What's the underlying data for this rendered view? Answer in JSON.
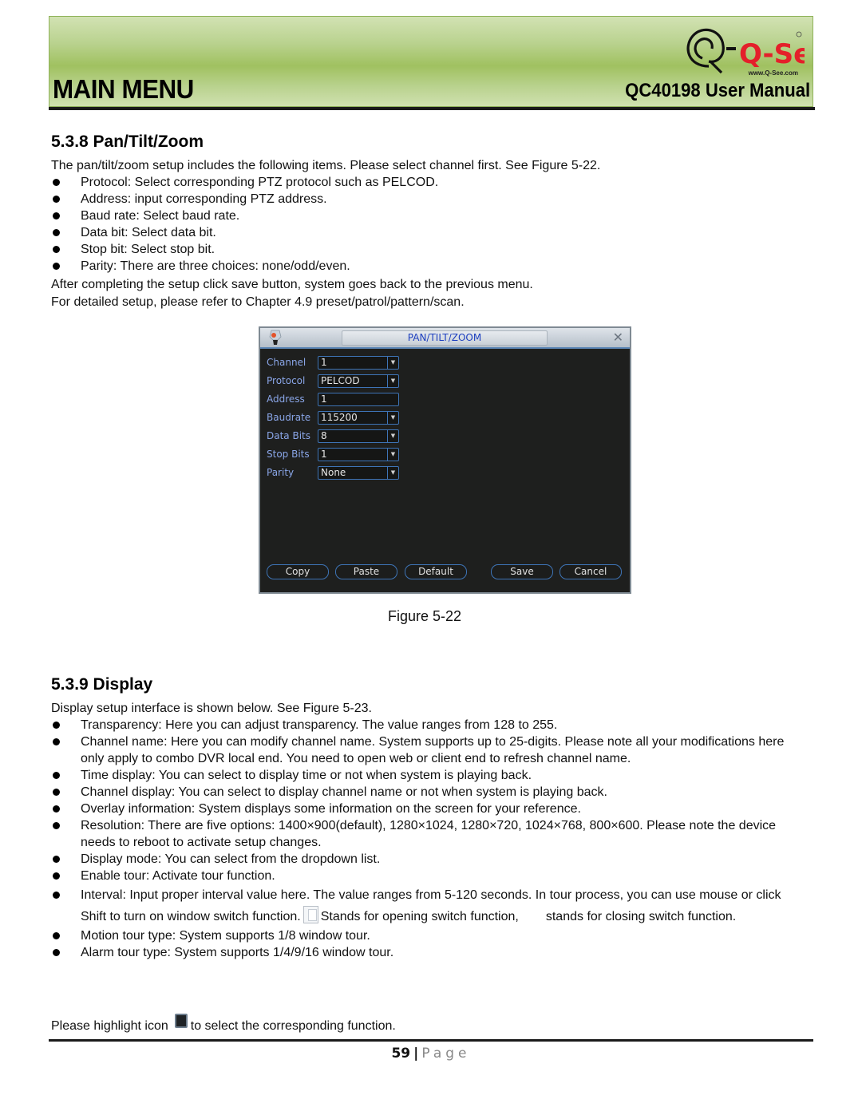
{
  "header": {
    "title": "MAIN MENU",
    "subtitle": "QC40198 User Manual",
    "logo_text": "Q-See",
    "logo_url": "www.Q-See.com",
    "logo_color": "#e4202a"
  },
  "section_ptz": {
    "heading": "5.3.8  Pan/Tilt/Zoom",
    "intro": "The pan/tilt/zoom setup includes the following items. Please select channel first. See Figure 5-22.",
    "bullets": [
      "Protocol: Select corresponding PTZ protocol such as PELCOD.",
      "Address: input corresponding PTZ address.",
      "Baud rate: Select baud rate.",
      "Data bit: Select data bit.",
      "Stop bit: Select stop bit.",
      "Parity: There are three choices: none/odd/even."
    ],
    "after_1": "After completing the setup click save button, system goes back to the previous menu.",
    "after_2": "For detailed setup, please refer to Chapter 4.9 preset/patrol/pattern/scan."
  },
  "dialog": {
    "title": "PAN/TILT/ZOOM",
    "close_symbol": "✕",
    "fields": [
      {
        "label": "Channel",
        "value": "1",
        "dropdown": true
      },
      {
        "label": "Protocol",
        "value": "PELCOD",
        "dropdown": true
      },
      {
        "label": "Address",
        "value": "1",
        "dropdown": false
      },
      {
        "label": "Baudrate",
        "value": "115200",
        "dropdown": true
      },
      {
        "label": "Data Bits",
        "value": "8",
        "dropdown": true
      },
      {
        "label": "Stop Bits",
        "value": "1",
        "dropdown": true
      },
      {
        "label": "Parity",
        "value": "None",
        "dropdown": true
      }
    ],
    "dropdown_arrow": "▼",
    "buttons": {
      "copy": "Copy",
      "paste": "Paste",
      "default": "Default",
      "save": "Save",
      "cancel": "Cancel"
    }
  },
  "figure_caption": "Figure 5-22",
  "section_display": {
    "heading": "5.3.9  Display",
    "intro": "Display setup interface is shown below. See Figure 5-23.",
    "bullets": [
      "Transparency: Here you can adjust transparency. The value ranges from 128 to 255.",
      "Channel name: Here you can modify channel name. System supports up to 25-digits. Please note all your modifications here only apply to combo DVR local end. You need to open web or client end to refresh channel name.",
      "Time display: You can select to display time or not when system is playing back.",
      "Channel display: You can select to display channel name or not when system is playing back.",
      "Overlay information: System displays some information on the screen for your reference.",
      "Resolution: There are five options: 1400×900(default), 1280×1024, 1280×720, 1024×768, 800×600. Please note the device needs to reboot to activate setup changes.",
      "Display mode: You can select from the dropdown list.",
      "Enable tour: Activate tour function."
    ],
    "interval_a": "Interval: Input proper interval value here. The value ranges from 5-120 seconds. In tour process, you can use mouse or click Shift to turn on window switch function.",
    "interval_b": "Stands for opening switch function,",
    "interval_c": "stands for closing switch function.",
    "bullets_after": [
      "Motion tour type: System supports 1/8 window tour.",
      "Alarm tour type: System supports 1/4/9/16 window tour."
    ],
    "highlight_a": "Please highlight icon",
    "highlight_b": "to select the corresponding function."
  },
  "footer": {
    "page_number": "59",
    "separator": "|",
    "page_label": "Page"
  }
}
